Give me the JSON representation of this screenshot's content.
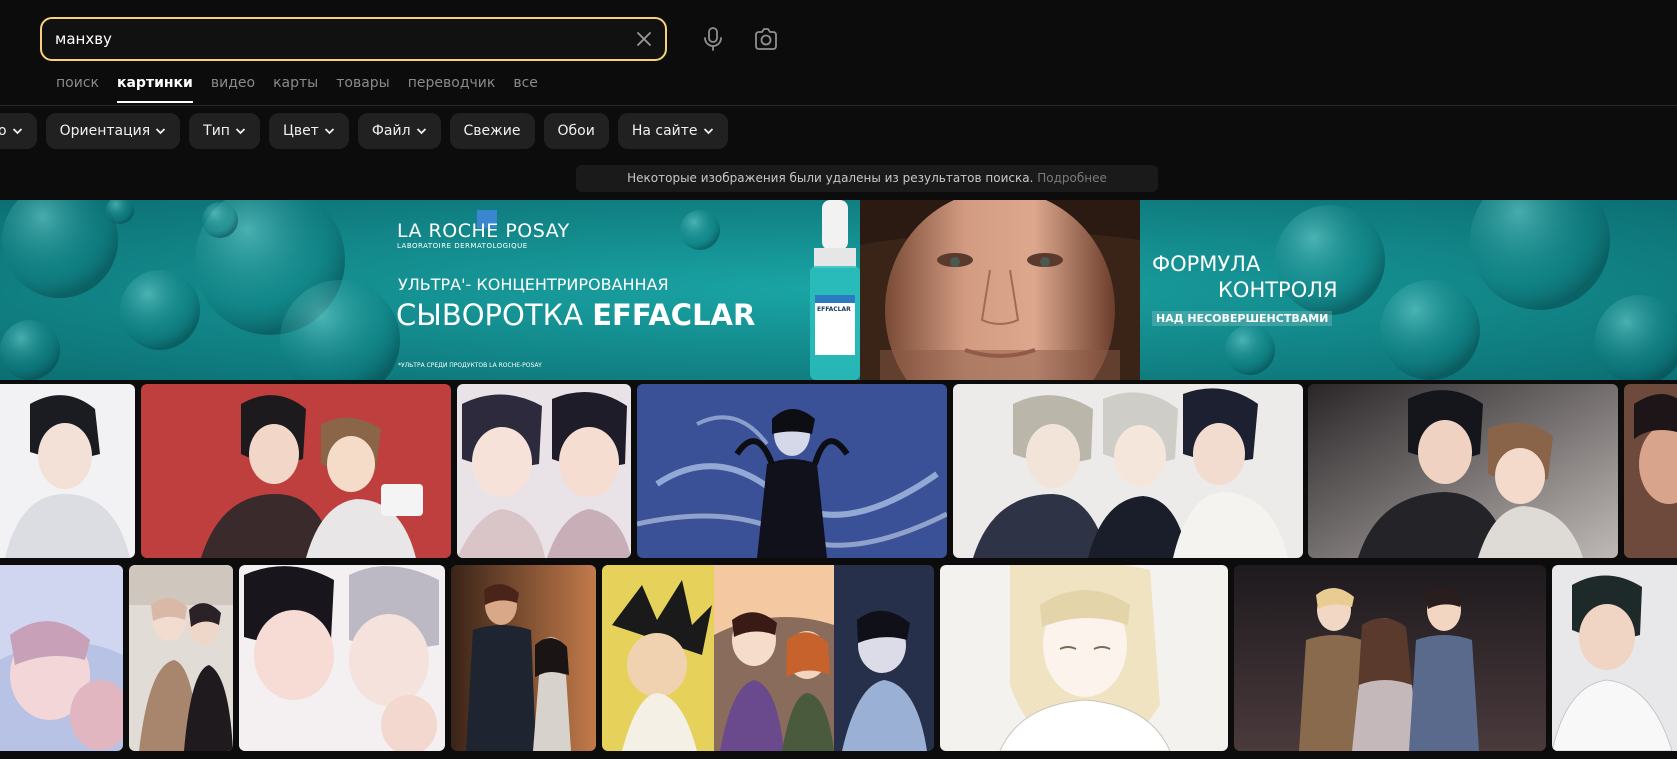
{
  "search": {
    "query": "манхву"
  },
  "tabs": [
    "поиск",
    "картинки",
    "видео",
    "карты",
    "товары",
    "переводчик",
    "все"
  ],
  "active_tab": 1,
  "filters": {
    "partial": "о",
    "orientation": "Ориентация",
    "type": "Тип",
    "color": "Цвет",
    "file": "Файл",
    "fresh": "Свежие",
    "wallpapers": "Обои",
    "on_site": "На сайте"
  },
  "notice": {
    "text": "Некоторые изображения были удалены из результатов поиска.",
    "link": "Подробнее"
  },
  "ad": {
    "brand": "LA ROCHE POSAY",
    "brand_sub": "LABORATOIRE DERMATOLOGIQUE",
    "headline_1": "УЛЬТРА'- КОНЦЕНТРИРОВАННАЯ",
    "headline_2": "СЫВОРОТКА",
    "headline_3": "EFFACLAR",
    "footnote": "*УЛЬТРА СРЕДИ ПРОДУКТОВ LA ROCHE-POSAY",
    "bottle_label": "EFFACLAR",
    "formula_1": "ФОРМУЛА",
    "formula_2": "КОНТРОЛЯ",
    "formula_3": "НАД НЕСОВЕРШЕНСТВАМИ"
  },
  "colors": {
    "accent_border": "#f7d27a",
    "chip_bg": "#212121",
    "banner_teal": "#138d8f",
    "background": "#0c0c0c"
  }
}
